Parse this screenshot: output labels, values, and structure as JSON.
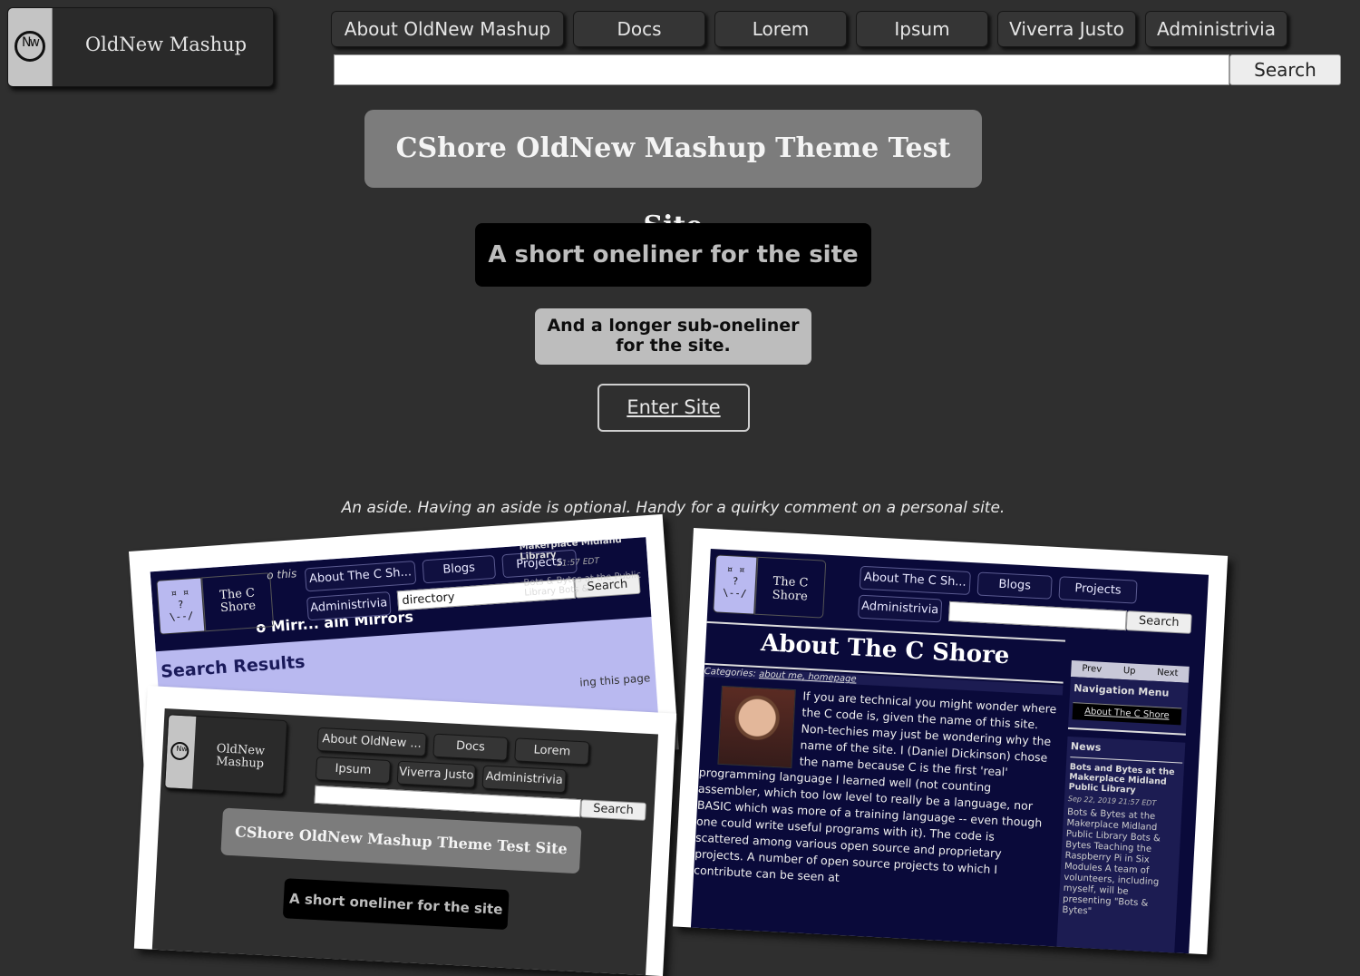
{
  "header": {
    "logo_letters": "Nw",
    "site_name": "OldNew Mashup",
    "nav": [
      "About OldNew Mashup",
      "Docs",
      "Lorem",
      "Ipsum",
      "Viverra Justo",
      "Administrivia"
    ],
    "search_placeholder": "",
    "search_label": "Search"
  },
  "hero": {
    "title": "CShore OldNew Mashup Theme Test Site",
    "oneliner": "A short oneliner for the site",
    "suboneliner": "And a longer sub-oneliner for the site.",
    "enter_label": "Enter Site",
    "aside": "An aside. Having an aside is optional. Handy for a quirky comment on a personal site."
  },
  "screenshots": {
    "cshore_search": {
      "logo_face": "¤ ¤\n ? \n\\--/",
      "site_name": "The C Shore",
      "nav": [
        "About The C Sh...",
        "Blogs",
        "Projects",
        "Administrivia"
      ],
      "search_value": "directory",
      "search_label": "Search",
      "tagline_fragment": "o this",
      "title_fragment": "o Mirr... ain Mirrors",
      "sidebar_heading": "Makerplace Midland Library",
      "sidebar_date": "21:57 EDT",
      "sidebar_text": "Bots & Bytes at the Public Library Bots &",
      "results_heading": "Search Results",
      "results_fragment": "ing this page"
    },
    "oldnew_mini": {
      "logo_letters": "Nw",
      "site_name": "OldNew Mashup",
      "nav": [
        "About OldNew ...",
        "Docs",
        "Lorem",
        "Ipsum",
        "Viverra Justo",
        "Administrivia"
      ],
      "search_label": "Search",
      "title": "CShore OldNew Mashup Theme Test Site",
      "oneliner": "A short oneliner for the site"
    },
    "cshore_about": {
      "logo_face": "¤ ¤\n ? \n\\--/",
      "site_name": "The C Shore",
      "nav": [
        "About The C Sh...",
        "Blogs",
        "Projects",
        "Administrivia"
      ],
      "search_label": "Search",
      "title": "About The C Shore",
      "categories_label": "Categories:",
      "categories": "about me, homepage",
      "body_wrapped": "If you are technical you might wonder where the C code is, given the name of this site. Non-techies may just be wondering why the name of the site. I (Daniel Dickinson) chose the name because C is the first 'real' programming language I learned well (not counting assembler,",
      "body_full": "which too low level to really be a language, nor BASIC which was more of a training language -- even though one could write useful programs with it). The code is scattered among various open source and proprietary projects. A number of open source projects to which I contribute can be seen at",
      "pager": [
        "Prev",
        "Up",
        "Next"
      ],
      "nav_menu_heading": "Navigation Menu",
      "nav_menu_item": "About The C Shore",
      "news_heading": "News",
      "news_title": "Bots and Bytes at the Makerplace Midland Public Library",
      "news_date": "Sep 22, 2019 21:57 EDT",
      "news_body": "Bots & Bytes at the Makerplace Midland Public Library Bots & Bytes Teaching the Raspberry Pi in Six Modules A team of volunteers, including myself, will be presenting \"Bots & Bytes\""
    }
  },
  "colors": {
    "page_bg": "#2f2f2f",
    "title_bg": "#7c7c7c",
    "oneliner_bg": "#000000",
    "suboneliner_bg": "#bdbdbd",
    "cshore_navy": "#0a0a3a",
    "cshore_lavender": "#b9b9f0"
  }
}
